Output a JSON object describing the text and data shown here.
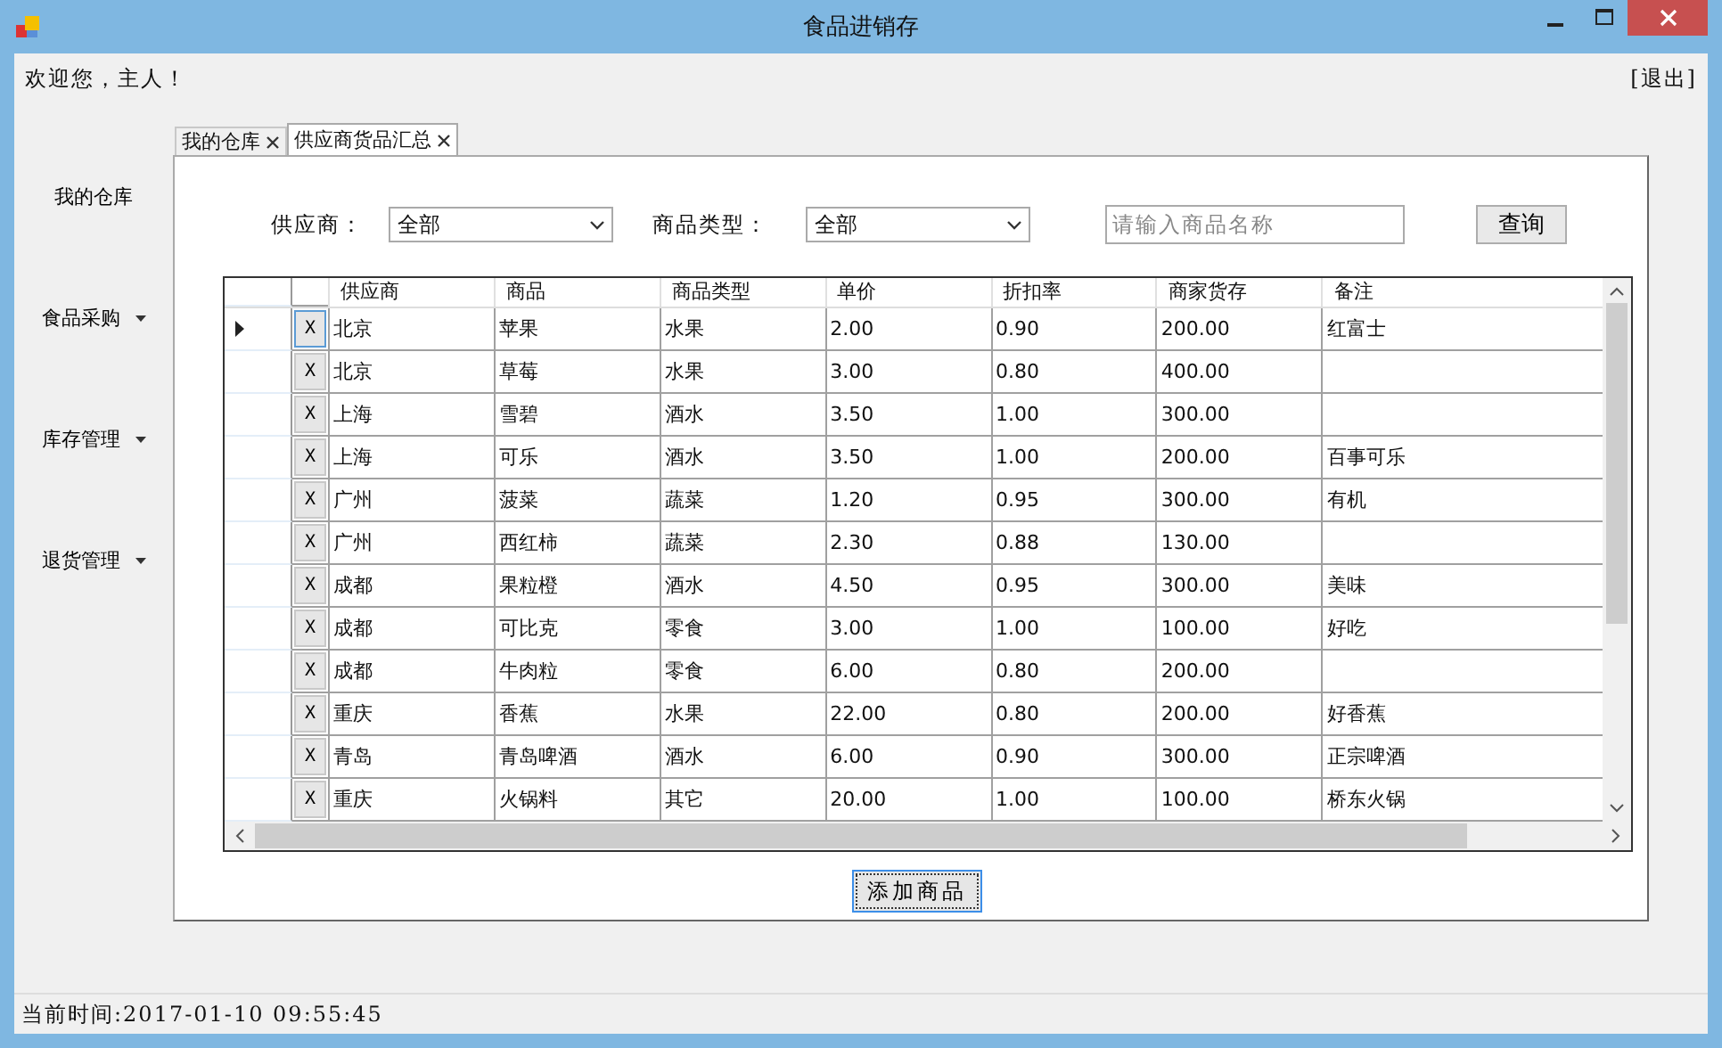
{
  "window": {
    "title": "食品进销存"
  },
  "welcome": "欢迎您，主人！",
  "exit_link": "[退出]",
  "sidebar": {
    "items": [
      {
        "label": "我的仓库",
        "kind": "link"
      },
      {
        "label": "食品采购",
        "kind": "menu"
      },
      {
        "label": "库存管理",
        "kind": "menu"
      },
      {
        "label": "退货管理",
        "kind": "menu"
      }
    ]
  },
  "tabs": [
    {
      "label": "我的仓库",
      "selected": false
    },
    {
      "label": "供应商货品汇总",
      "selected": true
    }
  ],
  "filters": {
    "supplier_label": "供应商：",
    "supplier_value": "全部",
    "type_label": "商品类型：",
    "type_value": "全部",
    "search": {
      "placeholder": "请输入商品名称"
    },
    "query_button": "查询"
  },
  "table": {
    "columns": [
      "供应商",
      "商品",
      "商品类型",
      "单价",
      "折扣率",
      "商家货存",
      "备注"
    ],
    "rows": [
      {
        "selected": true,
        "delete": "X",
        "cells": [
          "北京",
          "苹果",
          "水果",
          "2.00",
          "0.90",
          "200.00",
          "红富士"
        ]
      },
      {
        "selected": false,
        "delete": "X",
        "cells": [
          "北京",
          "草莓",
          "水果",
          "3.00",
          "0.80",
          "400.00",
          ""
        ]
      },
      {
        "selected": false,
        "delete": "X",
        "cells": [
          "上海",
          "雪碧",
          "酒水",
          "3.50",
          "1.00",
          "300.00",
          ""
        ]
      },
      {
        "selected": false,
        "delete": "X",
        "cells": [
          "上海",
          "可乐",
          "酒水",
          "3.50",
          "1.00",
          "200.00",
          "百事可乐"
        ]
      },
      {
        "selected": false,
        "delete": "X",
        "cells": [
          "广州",
          "菠菜",
          "蔬菜",
          "1.20",
          "0.95",
          "300.00",
          "有机"
        ]
      },
      {
        "selected": false,
        "delete": "X",
        "cells": [
          "广州",
          "西红柿",
          "蔬菜",
          "2.30",
          "0.88",
          "130.00",
          ""
        ]
      },
      {
        "selected": false,
        "delete": "X",
        "cells": [
          "成都",
          "果粒橙",
          "酒水",
          "4.50",
          "0.95",
          "300.00",
          "美味"
        ]
      },
      {
        "selected": false,
        "delete": "X",
        "cells": [
          "成都",
          "可比克",
          "零食",
          "3.00",
          "1.00",
          "100.00",
          "好吃"
        ]
      },
      {
        "selected": false,
        "delete": "X",
        "cells": [
          "成都",
          "牛肉粒",
          "零食",
          "6.00",
          "0.80",
          "200.00",
          ""
        ]
      },
      {
        "selected": false,
        "delete": "X",
        "cells": [
          "重庆",
          "香蕉",
          "水果",
          "22.00",
          "0.80",
          "200.00",
          "好香蕉"
        ]
      },
      {
        "selected": false,
        "delete": "X",
        "cells": [
          "青岛",
          "青岛啤酒",
          "酒水",
          "6.00",
          "0.90",
          "300.00",
          "正宗啤酒"
        ]
      },
      {
        "selected": false,
        "delete": "X",
        "cells": [
          "重庆",
          "火锅料",
          "其它",
          "20.00",
          "1.00",
          "100.00",
          "桥东火锅"
        ]
      }
    ]
  },
  "add_button": "添加商品",
  "status_bar": "当前时间:2017-01-10 09:55:45"
}
